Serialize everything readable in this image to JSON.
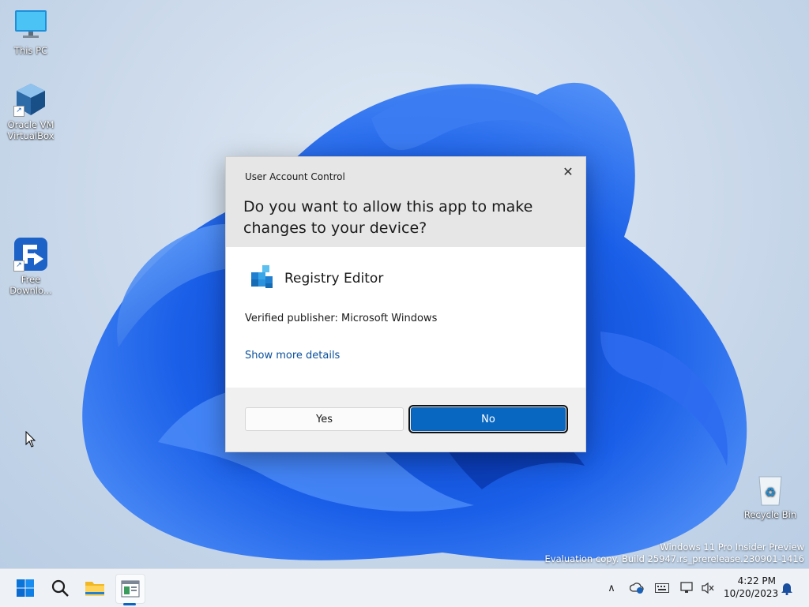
{
  "desktop": {
    "icons": [
      {
        "label": "This PC",
        "icon": "monitor-icon"
      },
      {
        "label": "Oracle VM VirtualBox",
        "label_line1": "Oracle VM",
        "label_line2": "VirtualBox",
        "icon": "virtualbox-icon"
      },
      {
        "label": "Free Downlo...",
        "label_line1": "Free",
        "label_line2": "Downlo...",
        "icon": "download-manager-icon"
      },
      {
        "label": "Recycle Bin",
        "icon": "recycle-bin-icon"
      }
    ],
    "watermark": {
      "line1": "Windows 11 Pro Insider Preview",
      "line2": "Evaluation copy. Build 25947.rs_prerelease.230901-1416"
    }
  },
  "uac": {
    "title": "User Account Control",
    "question": "Do you want to allow this app to make changes to your device?",
    "app_name": "Registry Editor",
    "publisher": "Verified publisher: Microsoft Windows",
    "more_details": "Show more details",
    "yes_label": "Yes",
    "no_label": "No",
    "close_glyph": "✕"
  },
  "taskbar": {
    "items": [
      "start-icon",
      "search-icon",
      "file-explorer-icon",
      "registry-editor-icon"
    ],
    "tray": {
      "chevron_glyph": "∧",
      "time": "4:22 PM",
      "date": "10/20/2023"
    }
  },
  "colors": {
    "accent": "#0867c1",
    "link": "#0a4f9c"
  }
}
